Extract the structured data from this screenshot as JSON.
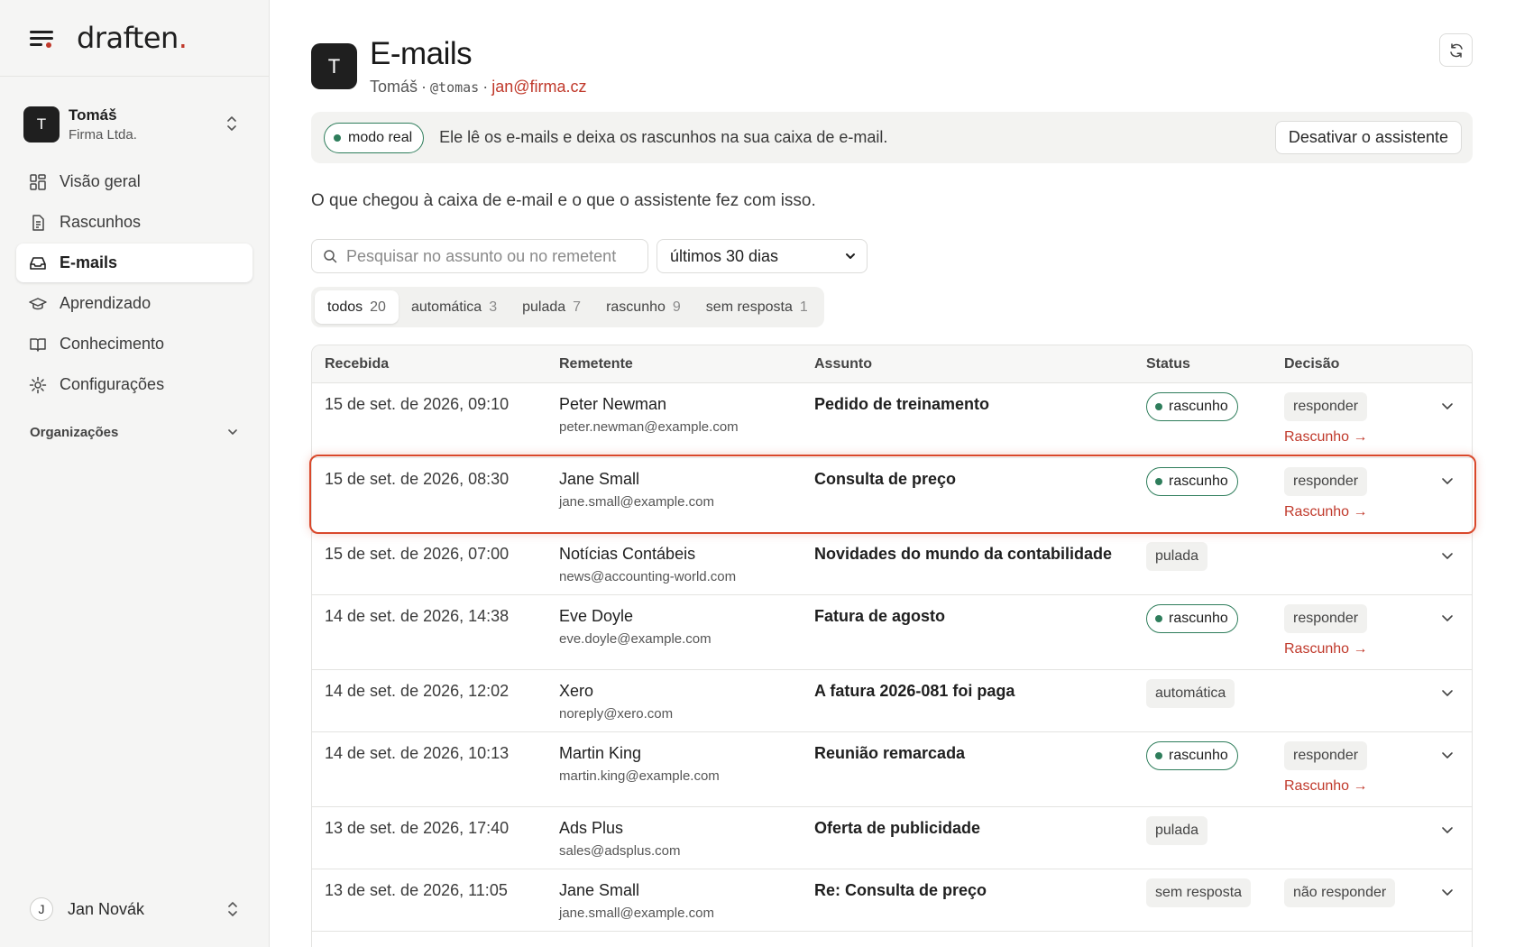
{
  "brand": {
    "name": "draften",
    "dot": "."
  },
  "account": {
    "avatar": "T",
    "name": "Tomáš",
    "org": "Firma Ltda."
  },
  "nav": [
    {
      "label": "Visão geral",
      "icon": "dashboard-icon"
    },
    {
      "label": "Rascunhos",
      "icon": "document-icon"
    },
    {
      "label": "E-mails",
      "icon": "inbox-icon",
      "active": true
    },
    {
      "label": "Aprendizado",
      "icon": "graduation-cap-icon"
    },
    {
      "label": "Conhecimento",
      "icon": "book-icon"
    },
    {
      "label": "Configurações",
      "icon": "gear-icon"
    }
  ],
  "orgs_label": "Organizações",
  "user": {
    "avatar": "J",
    "name": "Jan Novák"
  },
  "header": {
    "avatar": "T",
    "title": "E-mails",
    "name": "Tomáš",
    "sep1": "·",
    "handle": "@tomas",
    "sep2": "·",
    "email": "jan@firma.cz"
  },
  "banner": {
    "pill": "modo real",
    "text": "Ele lê os e-mails e deixa os rascunhos na sua caixa de e-mail.",
    "button": "Desativar o assistente"
  },
  "intro": "O que chegou à caixa de e-mail e o que o assistente fez com isso.",
  "search": {
    "placeholder": "Pesquisar no assunto ou no remetent"
  },
  "range": {
    "value": "últimos 30 dias"
  },
  "filters": [
    {
      "label": "todos",
      "count": "20",
      "active": true
    },
    {
      "label": "automática",
      "count": "3"
    },
    {
      "label": "pulada",
      "count": "7"
    },
    {
      "label": "rascunho",
      "count": "9"
    },
    {
      "label": "sem resposta",
      "count": "1"
    }
  ],
  "columns": {
    "received": "Recebida",
    "sender": "Remetente",
    "subject": "Assunto",
    "status": "Status",
    "decision": "Decisão"
  },
  "draft_link": "Rascunho →",
  "rows": [
    {
      "date": "15 de set. de 2026, 09:10",
      "name": "Peter Newman",
      "email": "peter.newman@example.com",
      "subject": "Pedido de treinamento",
      "status": "rascunho",
      "decision": "responder"
    },
    {
      "date": "15 de set. de 2026, 08:30",
      "name": "Jane Small",
      "email": "jane.small@example.com",
      "subject": "Consulta de preço",
      "status": "rascunho",
      "decision": "responder"
    },
    {
      "date": "15 de set. de 2026, 07:00",
      "name": "Notícias Contábeis",
      "email": "news@accounting-world.com",
      "subject": "Novidades do mundo da contabilidade",
      "status": "pulada",
      "decision": ""
    },
    {
      "date": "14 de set. de 2026, 14:38",
      "name": "Eve Doyle",
      "email": "eve.doyle@example.com",
      "subject": "Fatura de agosto",
      "status": "rascunho",
      "decision": "responder"
    },
    {
      "date": "14 de set. de 2026, 12:02",
      "name": "Xero",
      "email": "noreply@xero.com",
      "subject": "A fatura 2026-081 foi paga",
      "status": "automática",
      "decision": ""
    },
    {
      "date": "14 de set. de 2026, 10:13",
      "name": "Martin King",
      "email": "martin.king@example.com",
      "subject": "Reunião remarcada",
      "status": "rascunho",
      "decision": "responder"
    },
    {
      "date": "13 de set. de 2026, 17:40",
      "name": "Ads Plus",
      "email": "sales@adsplus.com",
      "subject": "Oferta de publicidade",
      "status": "pulada",
      "decision": ""
    },
    {
      "date": "13 de set. de 2026, 11:05",
      "name": "Jane Small",
      "email": "jane.small@example.com",
      "subject": "Re: Consulta de preço",
      "status": "sem resposta",
      "decision": "não responder"
    }
  ]
}
